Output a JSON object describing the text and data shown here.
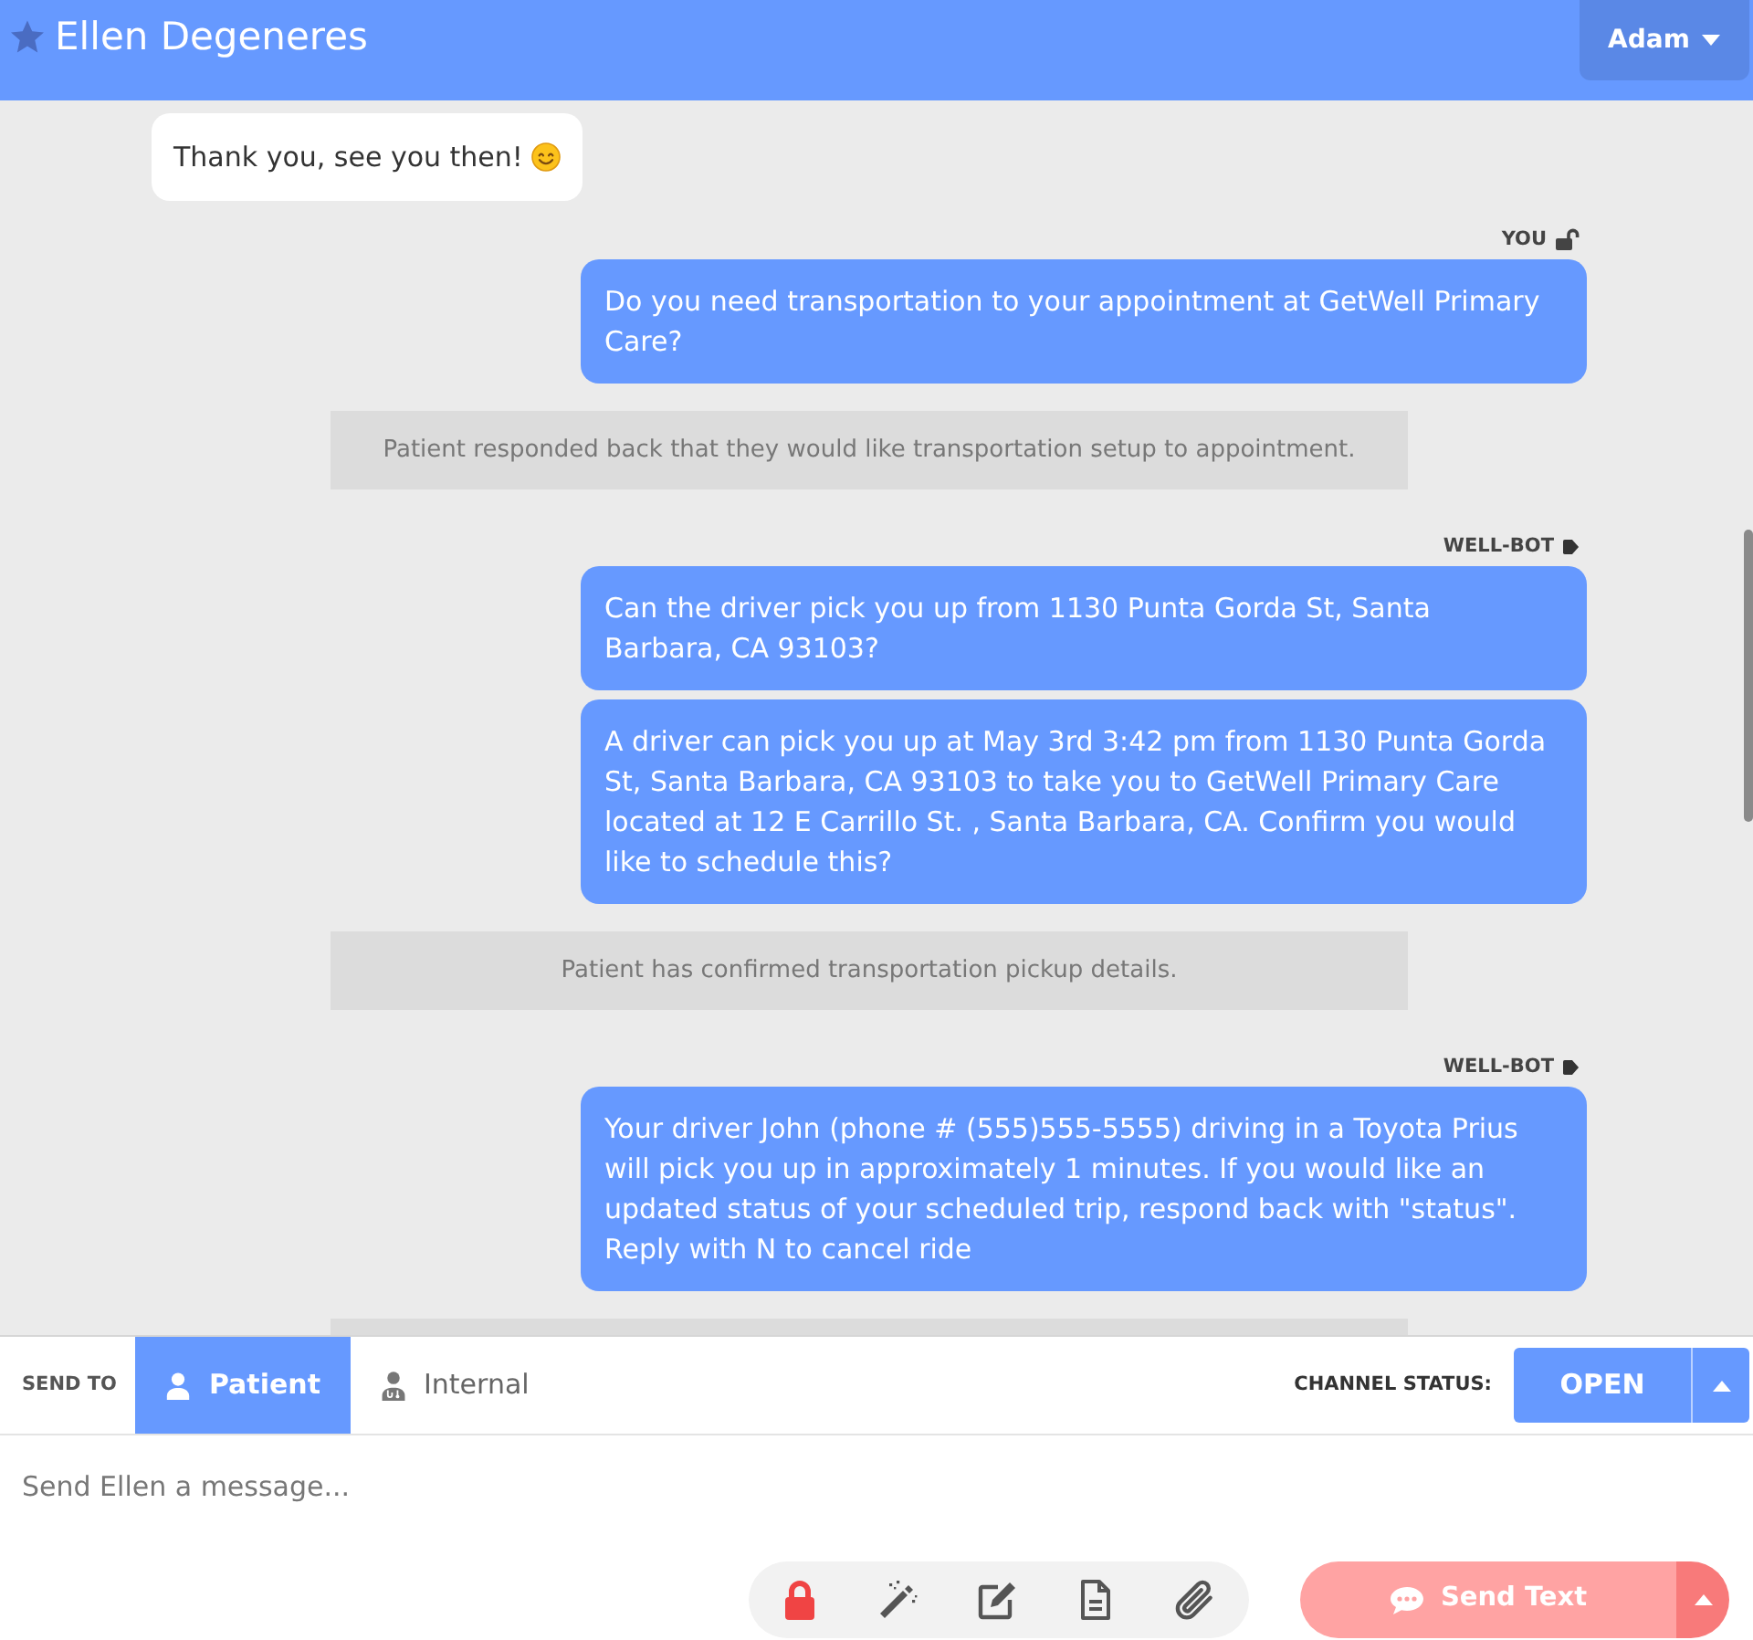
{
  "header": {
    "title": "Ellen Degeneres",
    "user_menu": {
      "label": "Adam"
    }
  },
  "messages": [
    {
      "kind": "incoming",
      "text": "Thank you, see you then!",
      "emoji": true
    },
    {
      "kind": "sender",
      "sender": {
        "label": "YOU",
        "kind": "user"
      }
    },
    {
      "kind": "outgoing",
      "text": "Do you need transportation to your appointment at GetWell Primary Care?"
    },
    {
      "kind": "note",
      "text": "Patient responded back that they would like transportation setup to appointment."
    },
    {
      "kind": "sender",
      "sender": {
        "label": "WELL-BOT",
        "kind": "bot"
      }
    },
    {
      "kind": "outgoing",
      "text": "Can the driver pick you up from 1130 Punta Gorda St, Santa Barbara, CA 93103?"
    },
    {
      "kind": "outgoing",
      "text": "A driver can pick you up at May 3rd 3:42 pm from 1130 Punta Gorda St, Santa Barbara, CA 93103 to take you to GetWell Primary Care located at 12 E Carrillo St. , Santa Barbara, CA. Confirm you would like to schedule this?"
    },
    {
      "kind": "note",
      "text": "Patient has confirmed transportation pickup details."
    },
    {
      "kind": "sender",
      "sender": {
        "label": "WELL-BOT",
        "kind": "bot"
      }
    },
    {
      "kind": "outgoing",
      "text": "Your driver John (phone # (555)555-5555) driving in a Toyota Prius will pick you up in approximately 1 minutes. If you would like an updated status of your scheduled trip, respond back with \"status\". Reply with N to cancel ride"
    },
    {
      "kind": "note"
    }
  ],
  "composer": {
    "send_to": {
      "label": "SEND TO",
      "tabs": [
        {
          "label": "Patient",
          "kind": "patient",
          "selected": true
        },
        {
          "label": "Internal",
          "kind": "internal",
          "selected": false
        }
      ]
    },
    "channel_status": {
      "label": "CHANNEL STATUS:",
      "value": "OPEN"
    },
    "message": {
      "placeholder": "Send Ellen a message..."
    },
    "send_button": {
      "label": "Send Text",
      "disabled": true
    }
  }
}
